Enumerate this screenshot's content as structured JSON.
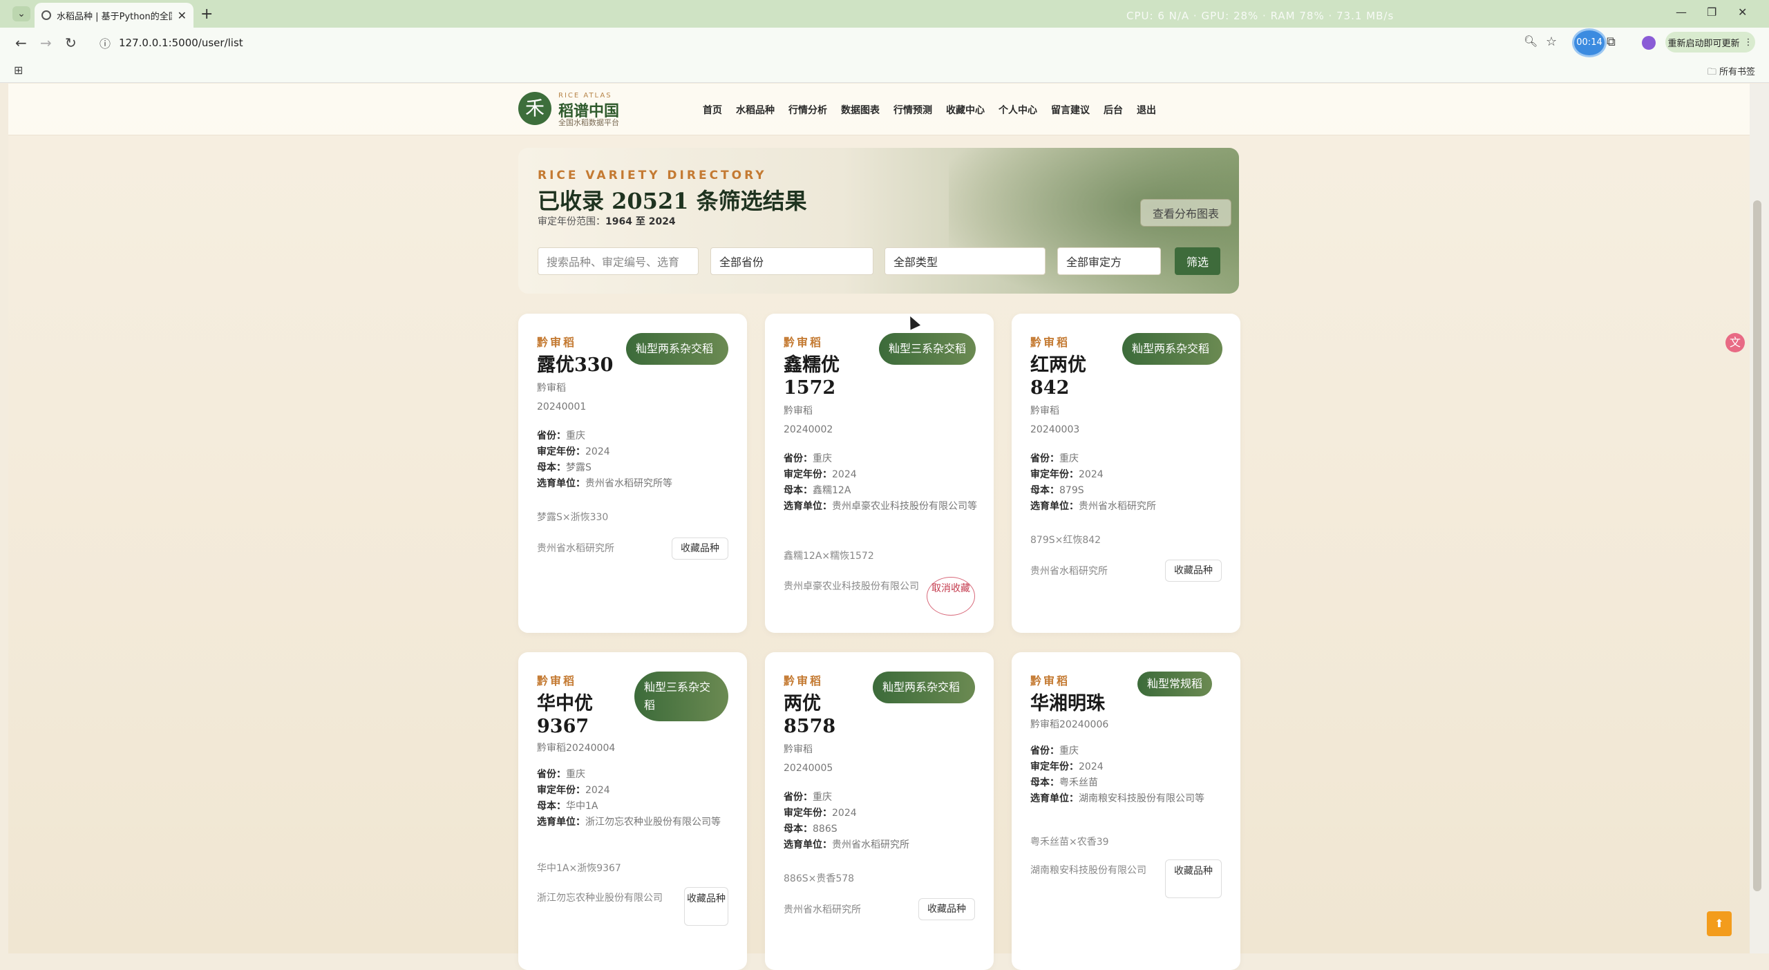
{
  "browser": {
    "tab_title": "水稻品种 | 基于Python的全国水稻",
    "tab_close": "✕",
    "new_tab": "+",
    "url": "127.0.0.1:5000/user/list",
    "system_overlay": "CPU: 6 N/A  ·  GPU: 28% · RAM  78% · 73.1 MB/s",
    "timer_badge": "00:14",
    "update_label": "重新启动即可更新",
    "bookmarks_all": "所有书签"
  },
  "site": {
    "logo_char": "禾",
    "logo_small": "RICE ATLAS",
    "logo_title": "稻谱中国",
    "logo_sub": "全国水稻数据平台",
    "nav": [
      "首页",
      "水稻品种",
      "行情分析",
      "数据图表",
      "行情预测",
      "收藏中心",
      "个人中心",
      "留言建议",
      "后台",
      "退出"
    ]
  },
  "hero": {
    "eyebrow": "RICE VARIETY DIRECTORY",
    "title": "已收录 20521 条筛选结果",
    "range_label": "审定年份范围：",
    "range_value": "1964 至 2024",
    "dist_button": "查看分布图表",
    "search_placeholder": "搜索品种、审定编号、选育",
    "province_select": "全部省份",
    "type_select": "全部类型",
    "authority_select": "全部审定方",
    "filter_button": "筛选"
  },
  "labels": {
    "province": "省份：",
    "year": "审定年份：",
    "parent": "母本：",
    "breeder": "选育单位："
  },
  "cards": [
    {
      "eyebrow": "黔审稻",
      "name": "露优330",
      "badge": "籼型两系杂交稻",
      "code": "黔审稻20240001",
      "province": "重庆",
      "year": "2024",
      "parent": "梦露S",
      "breeder": "贵州省水稻研究所等",
      "cross": "梦露S×浙恢330",
      "org": "贵州省水稻研究所",
      "fav": "收藏品种"
    },
    {
      "eyebrow": "黔审稻",
      "name": "鑫糯优1572",
      "badge": "籼型三系杂交稻",
      "code": "黔审稻20240002",
      "province": "重庆",
      "year": "2024",
      "parent": "鑫糯12A",
      "breeder": "贵州卓豪农业科技股份有限公司等",
      "cross": "鑫糯12A×糯恢1572",
      "org": "贵州卓豪农业科技股份有限公司",
      "fav": "取消收藏"
    },
    {
      "eyebrow": "黔审稻",
      "name": "红两优842",
      "badge": "籼型两系杂交稻",
      "code": "黔审稻20240003",
      "province": "重庆",
      "year": "2024",
      "parent": "879S",
      "breeder": "贵州省水稻研究所",
      "cross": "879S×红恢842",
      "org": "贵州省水稻研究所",
      "fav": "收藏品种"
    },
    {
      "eyebrow": "黔审稻",
      "name": "华中优9367",
      "badge": "籼型三系杂交稻",
      "code": "黔审稻20240004",
      "province": "重庆",
      "year": "2024",
      "parent": "华中1A",
      "breeder": "浙江勿忘农种业股份有限公司等",
      "cross": "华中1A×浙恢9367",
      "org": "浙江勿忘农种业股份有限公司",
      "fav": "收藏品种"
    },
    {
      "eyebrow": "黔审稻",
      "name": "两优8578",
      "badge": "籼型两系杂交稻",
      "code": "黔审稻20240005",
      "province": "重庆",
      "year": "2024",
      "parent": "886S",
      "breeder": "贵州省水稻研究所",
      "cross": "886S×贵香578",
      "org": "贵州省水稻研究所",
      "fav": "收藏品种"
    },
    {
      "eyebrow": "黔审稻",
      "name": "华湘明珠",
      "badge": "籼型常规稻",
      "code": "黔审稻20240006",
      "province": "重庆",
      "year": "2024",
      "parent": "粤禾丝苗",
      "breeder": "湖南粮安科技股份有限公司等",
      "cross": "粤禾丝苗×农香39",
      "org": "湖南粮安科技股份有限公司",
      "fav": "收藏品种"
    }
  ],
  "translate_icon": "文",
  "back_to_top": "⬆"
}
